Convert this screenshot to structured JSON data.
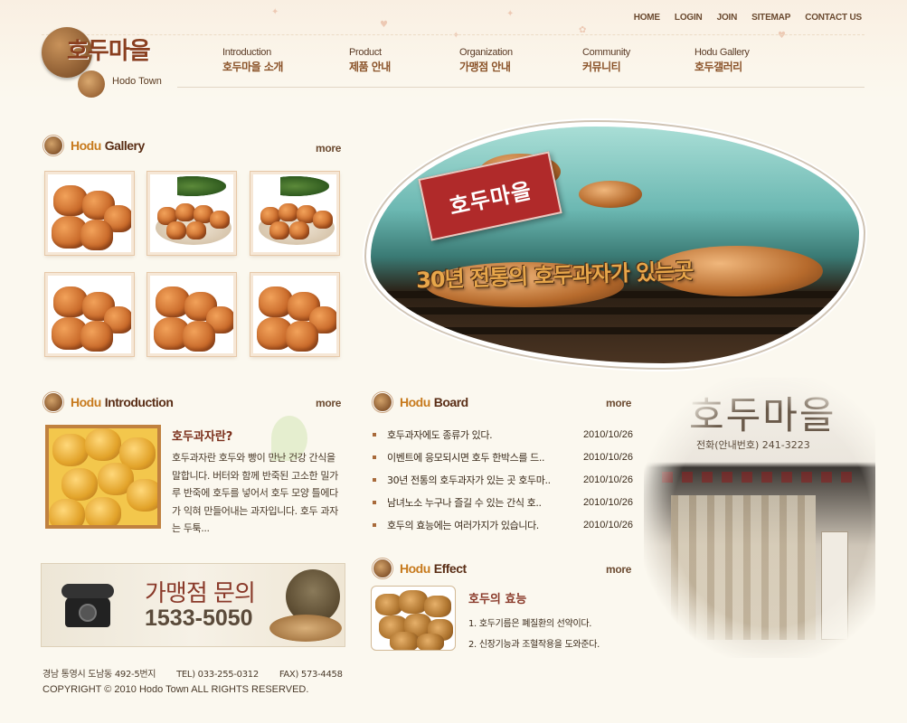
{
  "utility_nav": [
    "HOME",
    "LOGIN",
    "JOIN",
    "SITEMAP",
    "CONTACT US"
  ],
  "logo": {
    "korean": "호두마을",
    "english": "Hodo Town"
  },
  "gnb": [
    {
      "en": "Introduction",
      "ko": "호두마을 소개"
    },
    {
      "en": "Product",
      "ko": "제품 안내"
    },
    {
      "en": "Organization",
      "ko": "가맹점 안내"
    },
    {
      "en": "Community",
      "ko": "커뮤니티"
    },
    {
      "en": "Hodu Gallery",
      "ko": "호두갤러리"
    }
  ],
  "gallery": {
    "title_a": "Hodu",
    "title_b": "Gallery",
    "more": "more"
  },
  "banner": {
    "stamp": "호두마을",
    "caption": "30년 전통의 호두과자가 있는곳"
  },
  "introduction": {
    "title_a": "Hodu",
    "title_b": "Introduction",
    "more": "more",
    "question": "호두과자란?",
    "text": "호두과자란 호두와 빵이 만난 건강 간식을 말합니다. 버터와 함께 반죽된 고소한 밀가루 반죽에 호두를 넣어서 호두 모양 틀에다가 익혀 만들어내는 과자입니다. 호두 과자는 두툭..."
  },
  "board": {
    "title_a": "Hodu",
    "title_b": "Board",
    "more": "more",
    "posts": [
      {
        "title": "호두과자에도 종류가 있다.",
        "date": "2010/10/26"
      },
      {
        "title": "이벤트에 응모되시면 호두 한박스를 드..",
        "date": "2010/10/26"
      },
      {
        "title": "30년 전통의 호두과자가 있는 곳 호두마..",
        "date": "2010/10/26"
      },
      {
        "title": "남녀노소 누구나 즐길 수 있는 간식 호..",
        "date": "2010/10/26"
      },
      {
        "title": "호두의 효능에는 여러가지가 있습니다.",
        "date": "2010/10/26"
      }
    ]
  },
  "effect": {
    "title_a": "Hodu",
    "title_b": "Effect",
    "more": "more",
    "heading": "호두의 효능",
    "items": [
      "1. 호두기름은 폐질환의 선약이다.",
      "2. 신장기능과 조혈작용을 도와준다."
    ]
  },
  "contact": {
    "label": "가맹점 문의",
    "phone": "1533-5050"
  },
  "shop": {
    "sign": "호두마을",
    "tel": "전화(안내번호) 241-3223"
  },
  "footer": {
    "address": "경남 통영시 도남동 492-5번지",
    "tel": "TEL) 033-255-0312",
    "fax": "FAX) 573-4458",
    "copyright": "COPYRIGHT © 2010 Hodo Town ALL RIGHTS RESERVED."
  }
}
